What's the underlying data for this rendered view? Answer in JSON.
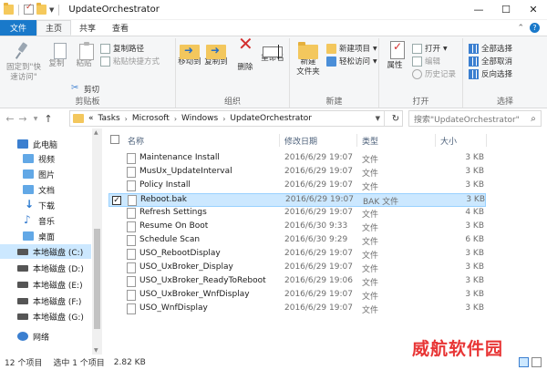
{
  "window": {
    "title": "UpdateOrchestrator",
    "min": "—",
    "max": "☐",
    "close": "✕"
  },
  "ribbon_tabs": [
    "文件",
    "主页",
    "共享",
    "查看"
  ],
  "ribbon": {
    "clipboard": {
      "pin": "固定到\"快\n速访问\"",
      "copy": "复制",
      "paste": "粘贴",
      "copy_path": "复制路径",
      "paste_shortcut": "粘贴快捷方式",
      "cut": "剪切",
      "label": "剪贴板"
    },
    "organize": {
      "move_to": "移动到",
      "copy_to": "复制到",
      "delete": "删除",
      "rename": "重命名",
      "label": "组织"
    },
    "new": {
      "new_folder": "新建\n文件夹",
      "new_item": "新建项目",
      "easy_access": "轻松访问",
      "label": "新建"
    },
    "open": {
      "properties": "属性",
      "open": "打开",
      "edit": "编辑",
      "history": "历史记录",
      "label": "打开"
    },
    "select": {
      "select_all": "全部选择",
      "select_none": "全部取消",
      "invert": "反向选择",
      "label": "选择"
    }
  },
  "address": {
    "prefix": "«",
    "crumbs": [
      "Tasks",
      "Microsoft",
      "Windows",
      "UpdateOrchestrator"
    ],
    "search_placeholder": "搜索\"UpdateOrchestrator\""
  },
  "nav": [
    {
      "label": "此电脑",
      "icon": "pc-icon"
    },
    {
      "label": "视频",
      "icon": "videos-folder-icon"
    },
    {
      "label": "图片",
      "icon": "pictures-folder-icon"
    },
    {
      "label": "文档",
      "icon": "documents-folder-icon"
    },
    {
      "label": "下载",
      "icon": "downloads-icon"
    },
    {
      "label": "音乐",
      "icon": "music-icon"
    },
    {
      "label": "桌面",
      "icon": "desktop-folder-icon"
    },
    {
      "label": "本地磁盘 (C:)",
      "icon": "drive-icon"
    },
    {
      "label": "本地磁盘 (D:)",
      "icon": "drive-icon"
    },
    {
      "label": "本地磁盘 (E:)",
      "icon": "drive-icon"
    },
    {
      "label": "本地磁盘 (F:)",
      "icon": "drive-icon"
    },
    {
      "label": "本地磁盘 (G:)",
      "icon": "drive-icon"
    },
    {
      "label": "网络",
      "icon": "network-icon"
    }
  ],
  "columns": {
    "name": "名称",
    "date": "修改日期",
    "type": "类型",
    "size": "大小"
  },
  "files": [
    {
      "name": "Maintenance Install",
      "date": "2016/6/29 19:07",
      "type": "文件",
      "size": "3 KB"
    },
    {
      "name": "MusUx_UpdateInterval",
      "date": "2016/6/29 19:07",
      "type": "文件",
      "size": "3 KB"
    },
    {
      "name": "Policy Install",
      "date": "2016/6/29 19:07",
      "type": "文件",
      "size": "3 KB"
    },
    {
      "name": "Reboot.bak",
      "date": "2016/6/29 19:07",
      "type": "BAK 文件",
      "size": "3 KB"
    },
    {
      "name": "Refresh Settings",
      "date": "2016/6/29 19:07",
      "type": "文件",
      "size": "4 KB"
    },
    {
      "name": "Resume On Boot",
      "date": "2016/6/30 9:33",
      "type": "文件",
      "size": "3 KB"
    },
    {
      "name": "Schedule Scan",
      "date": "2016/6/30 9:29",
      "type": "文件",
      "size": "6 KB"
    },
    {
      "name": "USO_RebootDisplay",
      "date": "2016/6/29 19:07",
      "type": "文件",
      "size": "3 KB"
    },
    {
      "name": "USO_UxBroker_Display",
      "date": "2016/6/29 19:07",
      "type": "文件",
      "size": "3 KB"
    },
    {
      "name": "USO_UxBroker_ReadyToReboot",
      "date": "2016/6/29 19:06",
      "type": "文件",
      "size": "3 KB"
    },
    {
      "name": "USO_UxBroker_WnfDisplay",
      "date": "2016/6/29 19:07",
      "type": "文件",
      "size": "3 KB"
    },
    {
      "name": "USO_WnfDisplay",
      "date": "2016/6/29 19:07",
      "type": "文件",
      "size": "3 KB"
    }
  ],
  "status": {
    "count": "12 个项目",
    "selected": "选中 1 个项目",
    "size": "2.82 KB"
  },
  "watermark": "威航软件园",
  "colors": {
    "accent": "#1979ca",
    "selection": "#cce8ff",
    "watermark": "#e83535"
  }
}
